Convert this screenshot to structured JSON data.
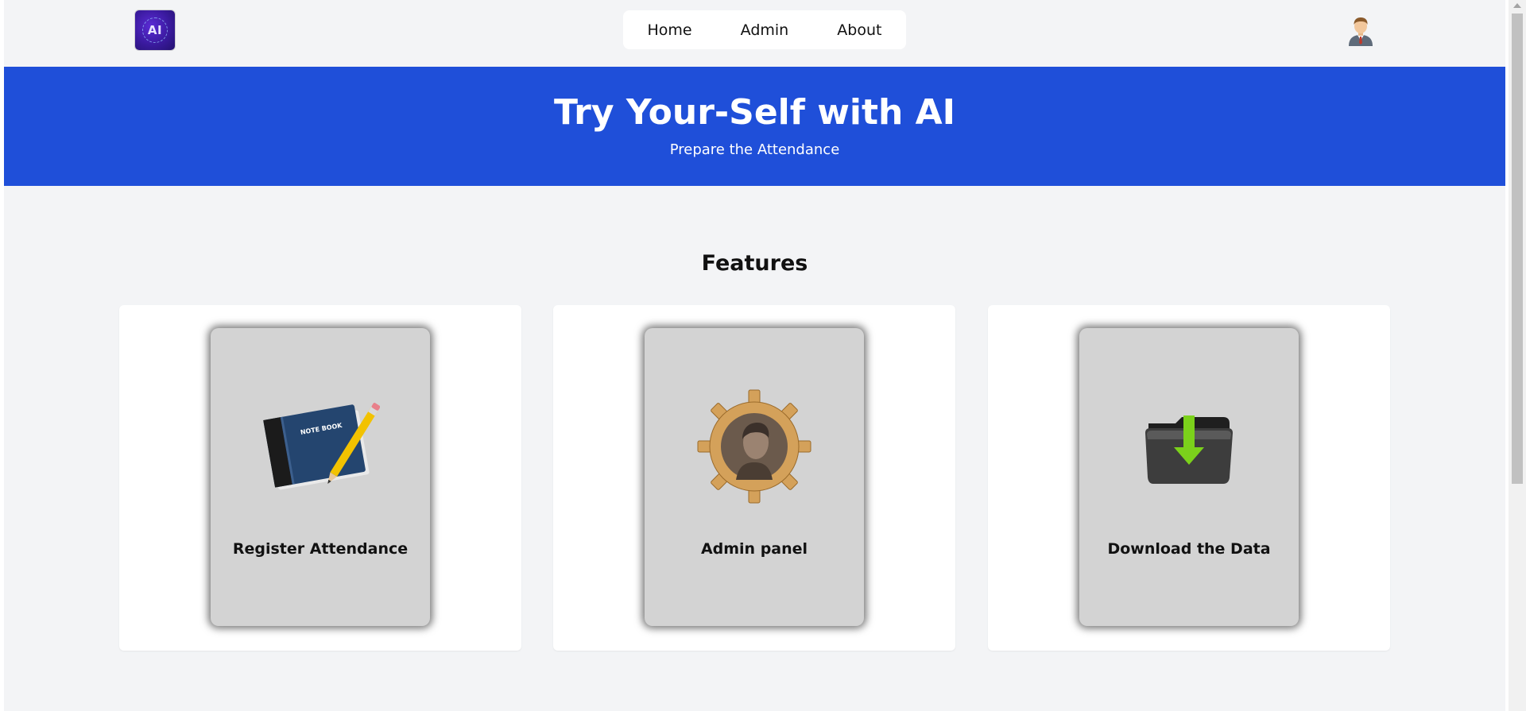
{
  "logo": {
    "text": "AI"
  },
  "nav": {
    "items": [
      {
        "label": "Home"
      },
      {
        "label": "Admin"
      },
      {
        "label": "About"
      }
    ]
  },
  "hero": {
    "title": "Try Your-Self with AI",
    "subtitle": "Prepare the Attendance"
  },
  "features": {
    "title": "Features",
    "cards": [
      {
        "label": "Register Attendance",
        "icon": "notebook-pencil-icon"
      },
      {
        "label": "Admin panel",
        "icon": "gear-person-icon"
      },
      {
        "label": "Download the Data",
        "icon": "folder-download-icon"
      }
    ]
  },
  "colors": {
    "hero_bg": "#1f4fd9",
    "page_bg": "#f3f4f6",
    "tile_bg": "#d3d3d3"
  }
}
